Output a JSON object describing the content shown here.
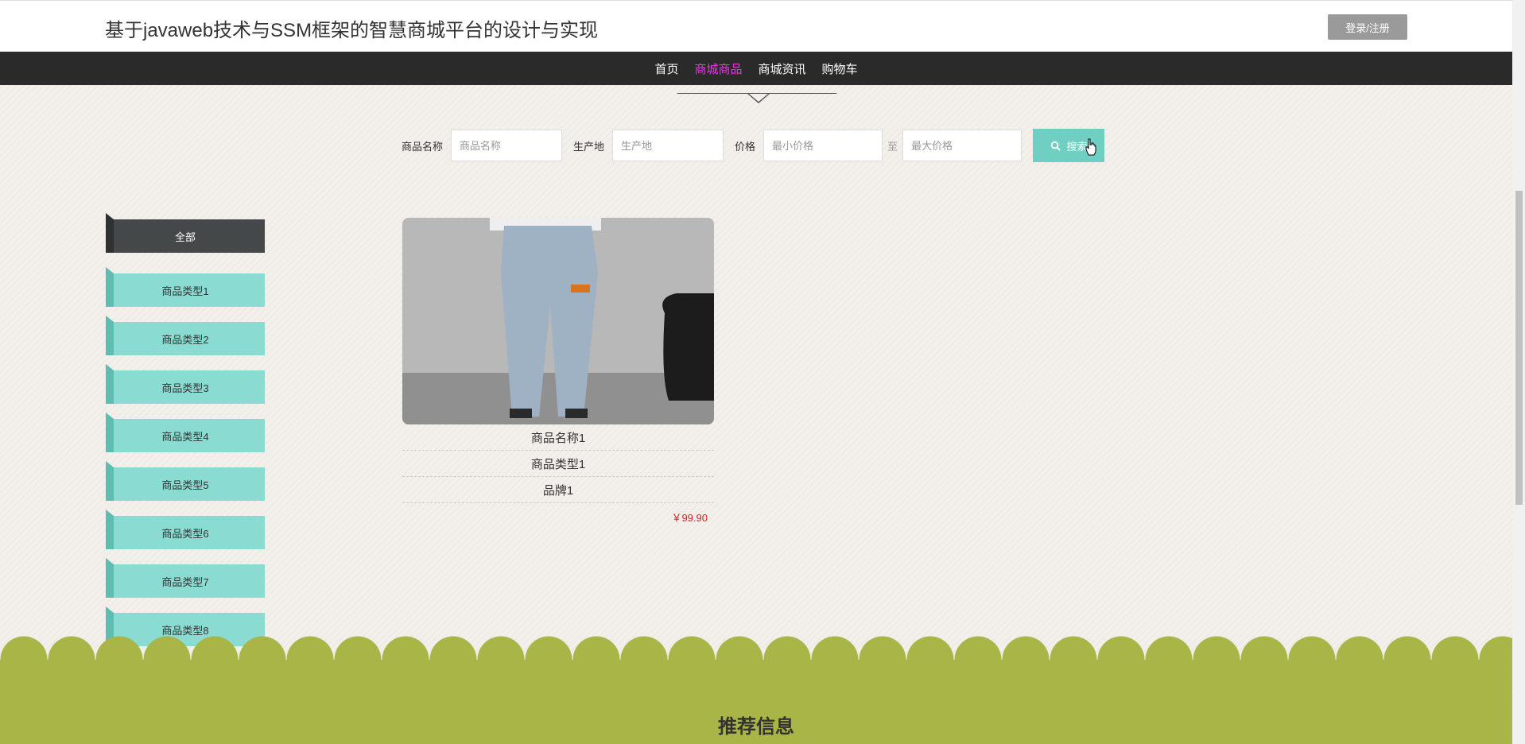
{
  "header": {
    "site_title": "基于javaweb技术与SSM框架的智慧商城平台的设计与实现",
    "login_label": "登录/注册"
  },
  "nav": {
    "items": [
      {
        "label": "首页",
        "active": false
      },
      {
        "label": "商城商品",
        "active": true
      },
      {
        "label": "商城资讯",
        "active": false
      },
      {
        "label": "购物车",
        "active": false
      }
    ],
    "active_color": "#e536e5"
  },
  "search": {
    "name_label": "商品名称",
    "name_placeholder": "商品名称",
    "origin_label": "生产地",
    "origin_placeholder": "生产地",
    "price_label": "价格",
    "min_placeholder": "最小价格",
    "separator": "至",
    "max_placeholder": "最大价格",
    "button_label": "搜索",
    "button_icon": "search-icon",
    "button_color": "#6fcfc2"
  },
  "sidebar": {
    "all_label": "全部",
    "categories": [
      "商品类型1",
      "商品类型2",
      "商品类型3",
      "商品类型4",
      "商品类型5",
      "商品类型6",
      "商品类型7",
      "商品类型8"
    ],
    "category_color": "#8adbd1"
  },
  "products": [
    {
      "name": "商品名称1",
      "type": "商品类型1",
      "brand": "品牌1",
      "price": "￥99.90"
    }
  ],
  "footer": {
    "title": "推荐信息",
    "color": "#a9b546"
  }
}
